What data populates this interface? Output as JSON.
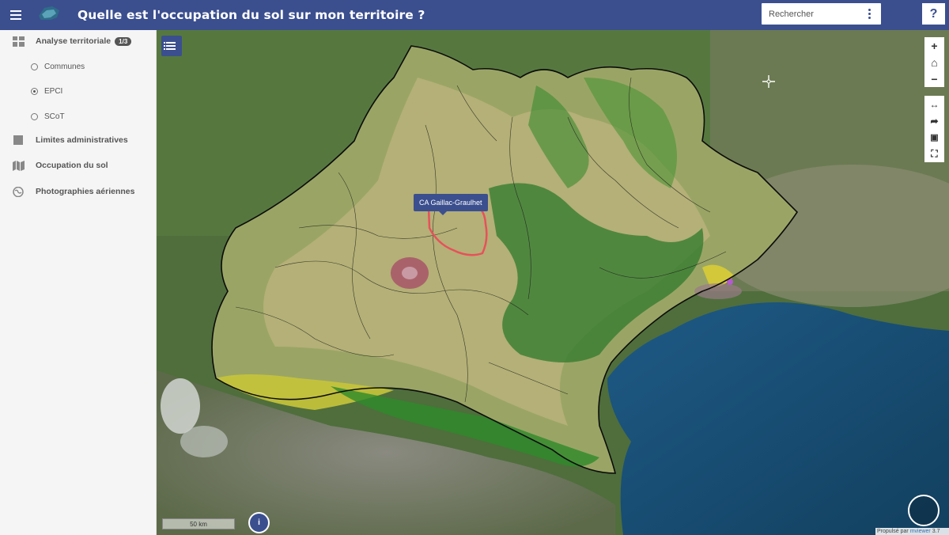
{
  "header": {
    "title": "Quelle est l'occupation du sol sur mon territoire ?",
    "search_placeholder": "Rechercher",
    "help_label": "?"
  },
  "sidebar": {
    "items": [
      {
        "label": "Analyse territoriale",
        "badge": "1/3",
        "icon": "grid-icon"
      },
      {
        "label": "Limites administratives",
        "icon": "square-icon"
      },
      {
        "label": "Occupation du sol",
        "icon": "map-icon"
      },
      {
        "label": "Photographies aériennes",
        "icon": "globe-icon"
      }
    ],
    "subitems": [
      {
        "label": "Communes",
        "checked": false
      },
      {
        "label": "EPCI",
        "checked": true
      },
      {
        "label": "SCoT",
        "checked": false
      }
    ]
  },
  "map": {
    "tooltip": "CA Gaillac-Graulhet",
    "scale_label": "50 km",
    "info_label": "i",
    "powered_prefix": "Propulsé par",
    "powered_link": "mviewer",
    "powered_version": "3.7",
    "controls_top": [
      "+",
      "⌂",
      "−"
    ],
    "controls_bottom": [
      "↔",
      "➦",
      "▣",
      "⛶"
    ]
  },
  "colors": {
    "brand": "#3b4f8f",
    "highlight_outline": "#e8505b"
  }
}
